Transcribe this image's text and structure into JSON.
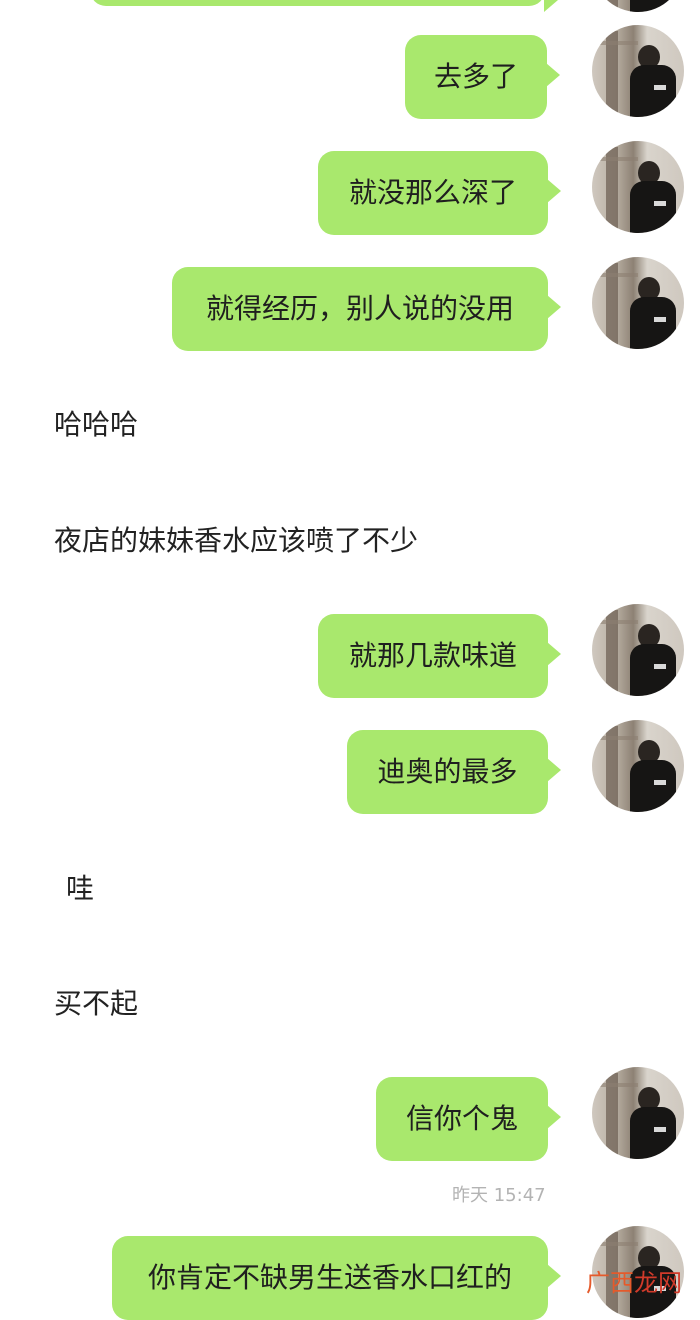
{
  "messages": [
    {
      "side": "right",
      "text": "去多了"
    },
    {
      "side": "right",
      "text": "就没那么深了"
    },
    {
      "side": "right",
      "text": "就得经历，别人说的没用"
    },
    {
      "side": "left",
      "text": "哈哈哈"
    },
    {
      "side": "left",
      "text": "夜店的妹妹香水应该喷了不少"
    },
    {
      "side": "right",
      "text": "就那几款味道"
    },
    {
      "side": "right",
      "text": "迪奥的最多"
    },
    {
      "side": "left",
      "text": "哇"
    },
    {
      "side": "left",
      "text": "买不起"
    },
    {
      "side": "right",
      "text": "信你个鬼"
    },
    {
      "side": "right",
      "text": "你肯定不缺男生送香水口红的"
    }
  ],
  "timestamp": "昨天 15:47",
  "watermark": {
    "part1": "广西",
    "part2": "龙网"
  },
  "colors": {
    "bubble": "#a9e86d",
    "background": "#ffffff"
  }
}
